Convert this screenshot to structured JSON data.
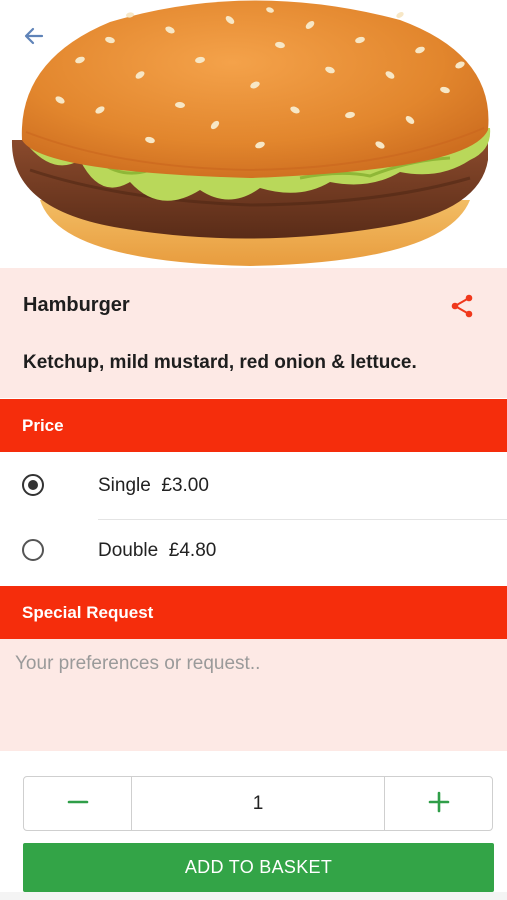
{
  "header": {
    "back_icon": "arrow-left-icon",
    "hero_image": "hamburger-photo"
  },
  "item": {
    "name": "Hamburger",
    "description": "Ketchup, mild mustard, red onion & lettuce.",
    "share_icon": "share-icon"
  },
  "price_section": {
    "title": "Price",
    "options": [
      {
        "label": "Single",
        "price": "£3.00",
        "selected": true
      },
      {
        "label": "Double",
        "price": "£4.80",
        "selected": false
      }
    ]
  },
  "request_section": {
    "title": "Special Request",
    "placeholder": "Your preferences or request.."
  },
  "quantity": {
    "value": "1",
    "decrement_icon": "minus-icon",
    "increment_icon": "plus-icon"
  },
  "add_button": {
    "label": "ADD TO BASKET"
  },
  "colors": {
    "accent": "#f52d0c",
    "panel": "#fde9e5",
    "primary_button": "#33a447",
    "stepper_icon": "#2f9e48"
  }
}
